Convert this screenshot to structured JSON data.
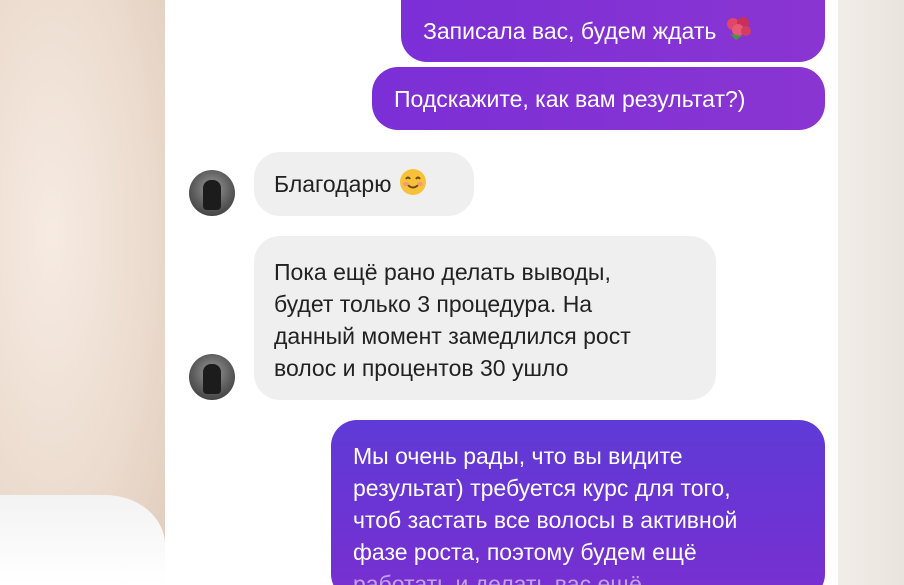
{
  "messages": [
    {
      "id": "msg1",
      "direction": "outgoing",
      "text": "Записала вас, будем ждать",
      "emoji": "flower-bouquet"
    },
    {
      "id": "msg2",
      "direction": "outgoing",
      "text": "Подскажите, как вам результат?)"
    },
    {
      "id": "msg3",
      "direction": "incoming",
      "text": "Благодарю",
      "emoji": "smiling-face"
    },
    {
      "id": "msg4",
      "direction": "incoming",
      "lines": [
        "Пока ещё рано делать выводы,",
        "будет только 3 процедура. На",
        "данный момент замедлился рост",
        "волос и процентов 30 ушло"
      ]
    },
    {
      "id": "msg5",
      "direction": "outgoing",
      "lines": [
        "Мы очень рады, что вы видите",
        "результат) требуется курс для того,",
        "чтоб застать все волосы в активной",
        "фазе роста, поэтому будем ещё",
        "работать и делать вас ещё"
      ]
    }
  ],
  "colors": {
    "outgoing_bubble": "#7b2fd6",
    "incoming_bubble": "#efefef",
    "screen_bg": "#ffffff"
  }
}
